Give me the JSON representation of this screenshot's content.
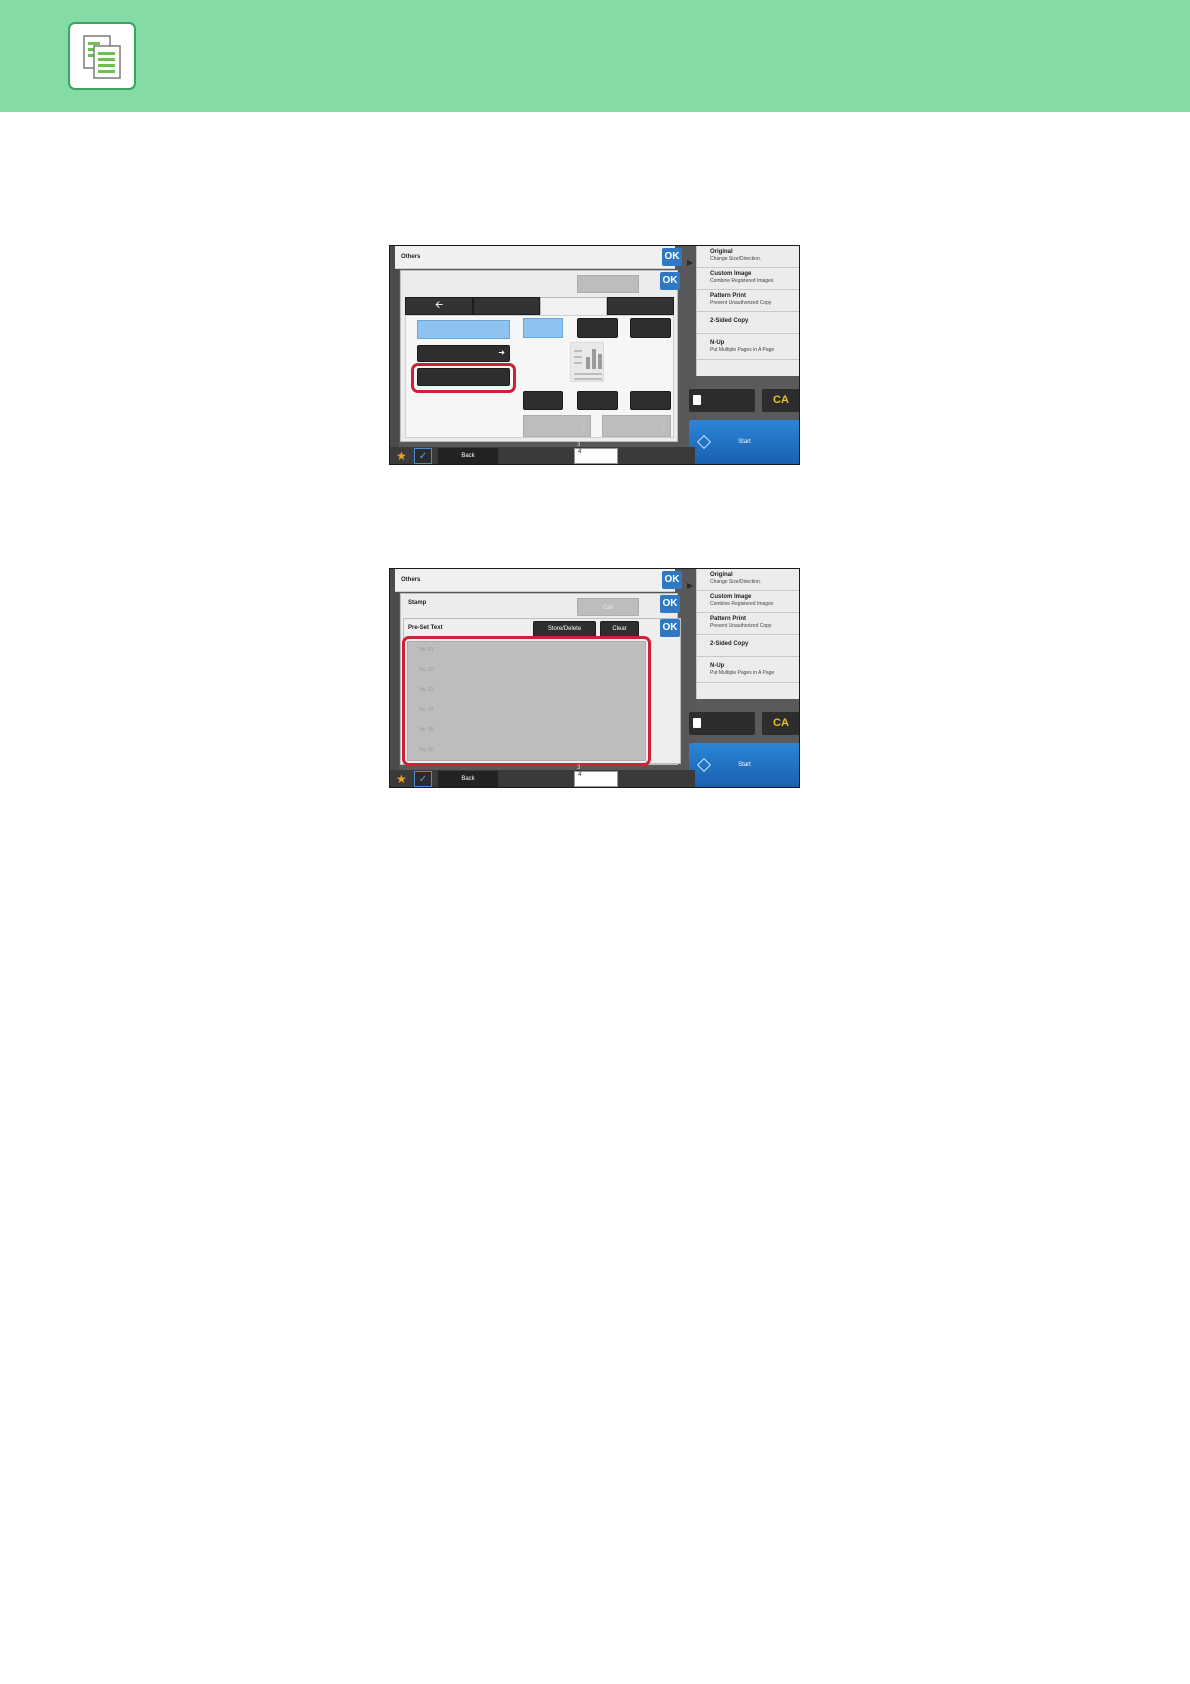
{
  "header": {
    "icon": "copy-documents-icon",
    "band_color": "#84dba6",
    "icon_border_color": "#3aa35f"
  },
  "highlight_color": "#cf2136",
  "screen1": {
    "title": "Others",
    "ok_label": "OK",
    "back_arrow_icon": "arrow-left-icon",
    "side_panel": [
      {
        "title": "Original",
        "sub": "Change Size/Direction."
      },
      {
        "title": "Custom Image",
        "sub": "Combine Registered Images"
      },
      {
        "title": "Pattern Print",
        "sub": "Prevent Unauthorized Copy"
      },
      {
        "title": "2-Sided Copy",
        "sub": ""
      },
      {
        "title": "N-Up",
        "sub": "Put Multiple Pages in A Page"
      }
    ],
    "ca_label": "CA",
    "start_label": "Start",
    "back_label": "Back",
    "counter_top": "3",
    "counter_value": "4"
  },
  "screen2": {
    "title": "Others",
    "sub_title": "Stamp",
    "section_title": "Pre-Set Text",
    "call_label": "Call",
    "store_delete_label": "Store/Delete",
    "clear_label": "Clear",
    "ok_label": "OK",
    "preset_rows": [
      "No. 01",
      "No. 02",
      "No. 03",
      "No. 04",
      "No. 05",
      "No. 06"
    ],
    "side_panel": [
      {
        "title": "Original",
        "sub": "Change Size/Direction."
      },
      {
        "title": "Custom Image",
        "sub": "Combine Registered Images"
      },
      {
        "title": "Pattern Print",
        "sub": "Prevent Unauthorized Copy"
      },
      {
        "title": "2-Sided Copy",
        "sub": ""
      },
      {
        "title": "N-Up",
        "sub": "Put Multiple Pages in A Page"
      }
    ],
    "ca_label": "CA",
    "start_label": "Start",
    "back_label": "Back",
    "counter_top": "3",
    "counter_value": "4"
  }
}
